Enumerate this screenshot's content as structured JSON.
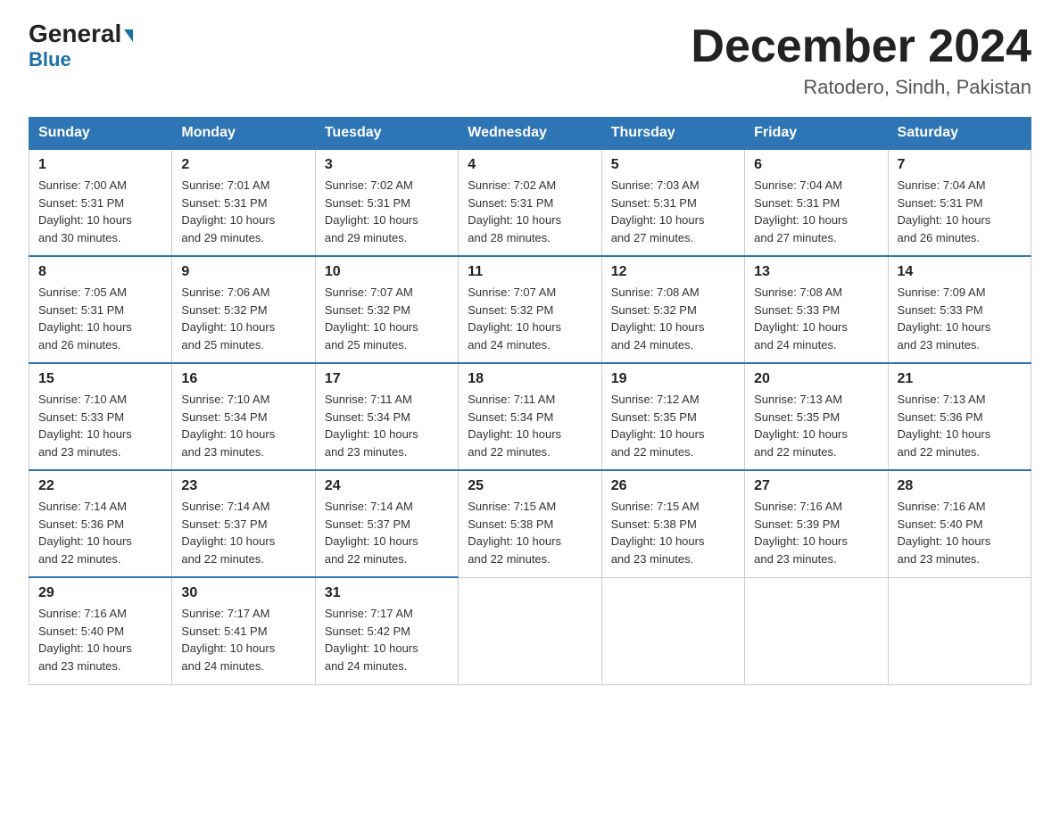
{
  "header": {
    "logo_general": "General",
    "logo_blue": "Blue",
    "month_title": "December 2024",
    "location": "Ratodero, Sindh, Pakistan"
  },
  "days_of_week": [
    "Sunday",
    "Monday",
    "Tuesday",
    "Wednesday",
    "Thursday",
    "Friday",
    "Saturday"
  ],
  "weeks": [
    [
      {
        "day": "1",
        "info": "Sunrise: 7:00 AM\nSunset: 5:31 PM\nDaylight: 10 hours\nand 30 minutes."
      },
      {
        "day": "2",
        "info": "Sunrise: 7:01 AM\nSunset: 5:31 PM\nDaylight: 10 hours\nand 29 minutes."
      },
      {
        "day": "3",
        "info": "Sunrise: 7:02 AM\nSunset: 5:31 PM\nDaylight: 10 hours\nand 29 minutes."
      },
      {
        "day": "4",
        "info": "Sunrise: 7:02 AM\nSunset: 5:31 PM\nDaylight: 10 hours\nand 28 minutes."
      },
      {
        "day": "5",
        "info": "Sunrise: 7:03 AM\nSunset: 5:31 PM\nDaylight: 10 hours\nand 27 minutes."
      },
      {
        "day": "6",
        "info": "Sunrise: 7:04 AM\nSunset: 5:31 PM\nDaylight: 10 hours\nand 27 minutes."
      },
      {
        "day": "7",
        "info": "Sunrise: 7:04 AM\nSunset: 5:31 PM\nDaylight: 10 hours\nand 26 minutes."
      }
    ],
    [
      {
        "day": "8",
        "info": "Sunrise: 7:05 AM\nSunset: 5:31 PM\nDaylight: 10 hours\nand 26 minutes."
      },
      {
        "day": "9",
        "info": "Sunrise: 7:06 AM\nSunset: 5:32 PM\nDaylight: 10 hours\nand 25 minutes."
      },
      {
        "day": "10",
        "info": "Sunrise: 7:07 AM\nSunset: 5:32 PM\nDaylight: 10 hours\nand 25 minutes."
      },
      {
        "day": "11",
        "info": "Sunrise: 7:07 AM\nSunset: 5:32 PM\nDaylight: 10 hours\nand 24 minutes."
      },
      {
        "day": "12",
        "info": "Sunrise: 7:08 AM\nSunset: 5:32 PM\nDaylight: 10 hours\nand 24 minutes."
      },
      {
        "day": "13",
        "info": "Sunrise: 7:08 AM\nSunset: 5:33 PM\nDaylight: 10 hours\nand 24 minutes."
      },
      {
        "day": "14",
        "info": "Sunrise: 7:09 AM\nSunset: 5:33 PM\nDaylight: 10 hours\nand 23 minutes."
      }
    ],
    [
      {
        "day": "15",
        "info": "Sunrise: 7:10 AM\nSunset: 5:33 PM\nDaylight: 10 hours\nand 23 minutes."
      },
      {
        "day": "16",
        "info": "Sunrise: 7:10 AM\nSunset: 5:34 PM\nDaylight: 10 hours\nand 23 minutes."
      },
      {
        "day": "17",
        "info": "Sunrise: 7:11 AM\nSunset: 5:34 PM\nDaylight: 10 hours\nand 23 minutes."
      },
      {
        "day": "18",
        "info": "Sunrise: 7:11 AM\nSunset: 5:34 PM\nDaylight: 10 hours\nand 22 minutes."
      },
      {
        "day": "19",
        "info": "Sunrise: 7:12 AM\nSunset: 5:35 PM\nDaylight: 10 hours\nand 22 minutes."
      },
      {
        "day": "20",
        "info": "Sunrise: 7:13 AM\nSunset: 5:35 PM\nDaylight: 10 hours\nand 22 minutes."
      },
      {
        "day": "21",
        "info": "Sunrise: 7:13 AM\nSunset: 5:36 PM\nDaylight: 10 hours\nand 22 minutes."
      }
    ],
    [
      {
        "day": "22",
        "info": "Sunrise: 7:14 AM\nSunset: 5:36 PM\nDaylight: 10 hours\nand 22 minutes."
      },
      {
        "day": "23",
        "info": "Sunrise: 7:14 AM\nSunset: 5:37 PM\nDaylight: 10 hours\nand 22 minutes."
      },
      {
        "day": "24",
        "info": "Sunrise: 7:14 AM\nSunset: 5:37 PM\nDaylight: 10 hours\nand 22 minutes."
      },
      {
        "day": "25",
        "info": "Sunrise: 7:15 AM\nSunset: 5:38 PM\nDaylight: 10 hours\nand 22 minutes."
      },
      {
        "day": "26",
        "info": "Sunrise: 7:15 AM\nSunset: 5:38 PM\nDaylight: 10 hours\nand 23 minutes."
      },
      {
        "day": "27",
        "info": "Sunrise: 7:16 AM\nSunset: 5:39 PM\nDaylight: 10 hours\nand 23 minutes."
      },
      {
        "day": "28",
        "info": "Sunrise: 7:16 AM\nSunset: 5:40 PM\nDaylight: 10 hours\nand 23 minutes."
      }
    ],
    [
      {
        "day": "29",
        "info": "Sunrise: 7:16 AM\nSunset: 5:40 PM\nDaylight: 10 hours\nand 23 minutes."
      },
      {
        "day": "30",
        "info": "Sunrise: 7:17 AM\nSunset: 5:41 PM\nDaylight: 10 hours\nand 24 minutes."
      },
      {
        "day": "31",
        "info": "Sunrise: 7:17 AM\nSunset: 5:42 PM\nDaylight: 10 hours\nand 24 minutes."
      },
      null,
      null,
      null,
      null
    ]
  ]
}
